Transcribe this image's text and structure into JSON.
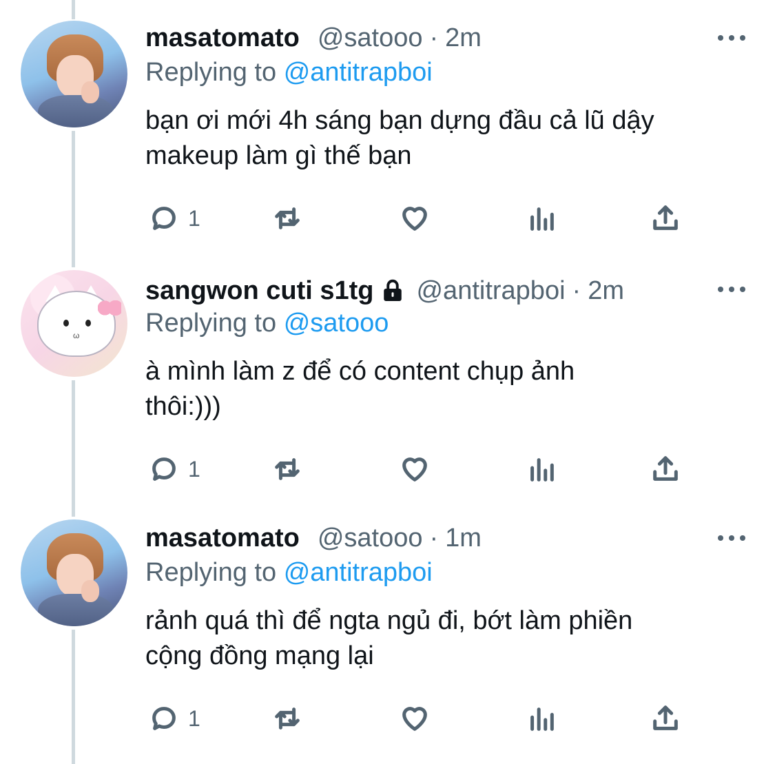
{
  "tweets": [
    {
      "name": "masatomato",
      "handle": "@satooo",
      "sep": "·",
      "time": "2m",
      "replying_prefix": "Replying to",
      "replying_to": "@antitrapboi",
      "text_lines": [
        "bạn ơi mới 4h sáng bạn dựng đầu cả lũ dậy",
        "makeup làm gì thế bạn"
      ],
      "reply_count": "1",
      "locked": false,
      "avatar": "masatomato-avatar"
    },
    {
      "name": "sangwon cuti s1tg",
      "handle": "@antitrapboi",
      "sep": "·",
      "time": "2m",
      "replying_prefix": "Replying to",
      "replying_to": "@satooo",
      "text_lines": [
        "à mình làm z để có content chụp ảnh",
        "thôi:)))"
      ],
      "reply_count": "1",
      "locked": true,
      "avatar": "hello-kitty-avatar"
    },
    {
      "name": "masatomato",
      "handle": "@satooo",
      "sep": "·",
      "time": "1m",
      "replying_prefix": "Replying to",
      "replying_to": "@antitrapboi",
      "text_lines": [
        "rảnh quá thì để ngta ngủ đi, bớt làm phiền",
        "cộng đồng mạng lại"
      ],
      "reply_count": "1",
      "locked": false,
      "avatar": "masatomato-avatar"
    }
  ],
  "icons": {
    "reply": "reply-icon",
    "retweet": "retweet-icon",
    "like": "heart-icon",
    "views": "analytics-icon",
    "share": "share-icon",
    "more": "more-icon",
    "lock": "lock-icon"
  },
  "colors": {
    "mention": "#1d9bf0",
    "secondary_text": "#536471",
    "primary_text": "#0f1419",
    "thread_line": "#cfd9de"
  }
}
